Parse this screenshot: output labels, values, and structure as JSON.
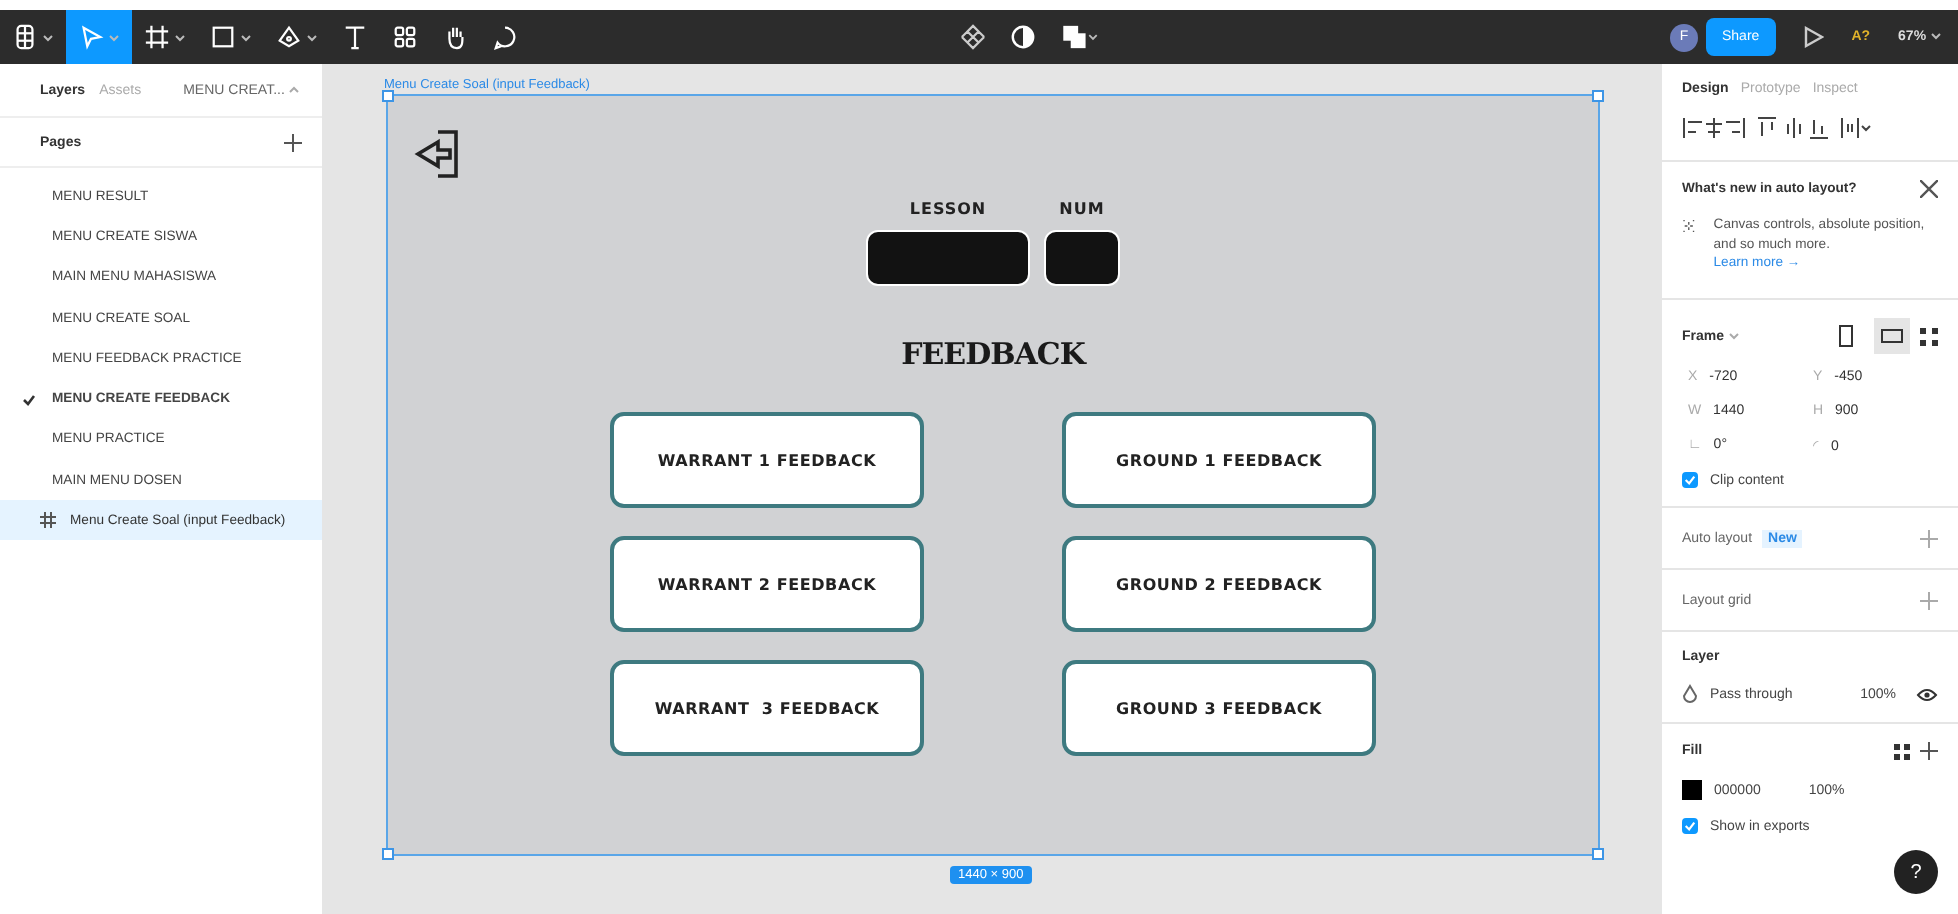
{
  "toolbar": {
    "tools": [
      {
        "kind": "logo",
        "selected": false,
        "caret": true
      },
      {
        "kind": "move",
        "selected": true,
        "caret": true
      },
      {
        "kind": "frame",
        "selected": false,
        "caret": true
      },
      {
        "kind": "shape",
        "selected": false,
        "caret": true
      },
      {
        "kind": "pen",
        "selected": false,
        "caret": true
      },
      {
        "kind": "text",
        "selected": false,
        "caret": false
      },
      {
        "kind": "resources",
        "selected": false,
        "caret": false
      },
      {
        "kind": "hand",
        "selected": false,
        "caret": false
      },
      {
        "kind": "comment",
        "selected": false,
        "caret": false
      }
    ],
    "center_tools": [
      {
        "kind": "component"
      },
      {
        "kind": "contrast"
      },
      {
        "kind": "boolean"
      }
    ],
    "avatar": "F",
    "share": "Share",
    "font_warning": "A?",
    "zoom": "67%"
  },
  "left_panel": {
    "tabs": [
      {
        "label": "Layers",
        "selected": true
      },
      {
        "label": "Assets",
        "selected": false
      }
    ],
    "page_dropdown": "MENU CREAT...",
    "pages_title": "Pages",
    "pages": [
      {
        "name": "MENU RESULT",
        "checked": false
      },
      {
        "name": "MENU CREATE SISWA",
        "checked": false
      },
      {
        "name": "MAIN MENU MAHASISWA",
        "checked": false
      },
      {
        "name": "MENU CREATE SOAL",
        "checked": false
      },
      {
        "name": "MENU FEEDBACK PRACTICE",
        "checked": false
      },
      {
        "name": "MENU CREATE FEEDBACK",
        "checked": true
      },
      {
        "name": "MENU PRACTICE",
        "checked": false
      },
      {
        "name": "MAIN MENU DOSEN",
        "checked": false
      }
    ],
    "layers": [
      {
        "name": "Menu Create Soal (input Feedback)",
        "selected": true
      }
    ]
  },
  "canvas": {
    "frame_label": "Menu Create Soal (input Feedback)",
    "size_badge": "1440 × 900",
    "fields": [
      {
        "label": "LESSON",
        "kind": "wide"
      },
      {
        "label": "NUM",
        "kind": "narrow"
      }
    ],
    "title": "FEEDBACK",
    "buttons": [
      {
        "label": "WARRANT 1 FEEDBACK"
      },
      {
        "label": "GROUND 1 FEEDBACK"
      },
      {
        "label": "WARRANT 2 FEEDBACK"
      },
      {
        "label": "GROUND 2 FEEDBACK"
      },
      {
        "label": "WARRANT  3 FEEDBACK"
      },
      {
        "label": "GROUND 3 FEEDBACK"
      }
    ]
  },
  "right_panel": {
    "tabs": [
      {
        "label": "Design",
        "selected": true
      },
      {
        "label": "Prototype",
        "selected": false
      },
      {
        "label": "Inspect",
        "selected": false
      }
    ],
    "notice": {
      "title": "What's new in auto layout?",
      "body": "Canvas controls, absolute position, and so much more.",
      "link": "Learn more →"
    },
    "frame": {
      "title": "Frame",
      "orientations": [
        {
          "kind": "portrait",
          "selected": false
        },
        {
          "kind": "landscape",
          "selected": true
        }
      ],
      "fields": [
        {
          "label": "X",
          "value": "-720"
        },
        {
          "label": "Y",
          "value": "-450"
        },
        {
          "label": "W",
          "value": "1440"
        },
        {
          "label": "H",
          "value": "900"
        },
        {
          "label": "∟",
          "value": "0°"
        },
        {
          "label": "◜",
          "value": "0"
        }
      ],
      "clip_content": {
        "label": "Clip content",
        "checked": true
      }
    },
    "auto_layout": {
      "title": "Auto layout",
      "badge": "New"
    },
    "layout_grid": {
      "title": "Layout grid"
    },
    "layer": {
      "title": "Layer",
      "blend": "Pass through",
      "opacity": "100%"
    },
    "fill": {
      "title": "Fill",
      "color": "#000000",
      "hex": "000000",
      "opacity": "100%",
      "show_in_exports": {
        "label": "Show in exports",
        "checked": true
      }
    },
    "help": "?"
  }
}
